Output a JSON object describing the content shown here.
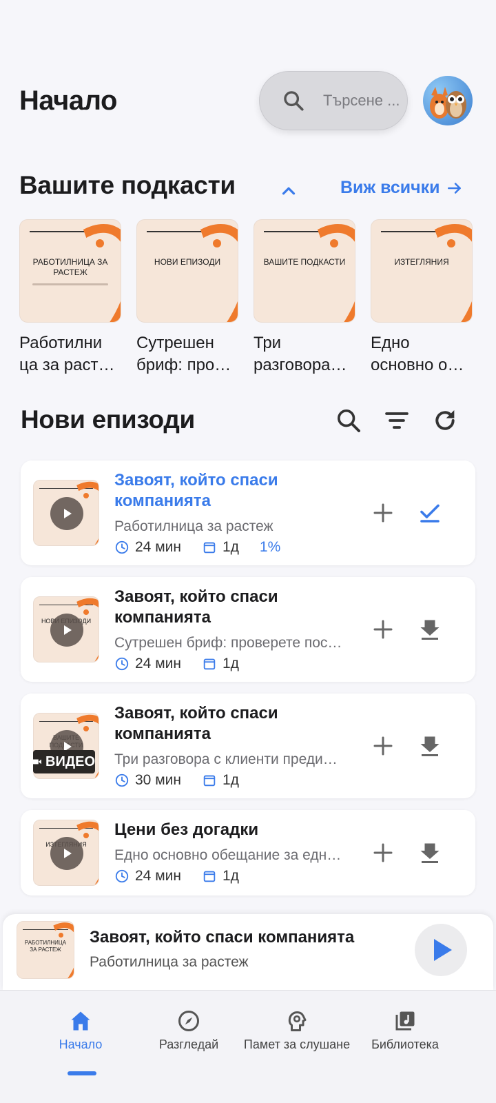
{
  "header": {
    "title": "Начало",
    "search_placeholder": "Търсене ..."
  },
  "podcasts_section": {
    "title": "Вашите подкасти",
    "see_all_label": "Виж всички",
    "items": [
      {
        "cover_text": "Работилница за растеж",
        "name": "Работилни ца за раст…"
      },
      {
        "cover_text": "Нови епизоди",
        "name": "Сутрешен бриф: про…"
      },
      {
        "cover_text": "Вашите подкасти",
        "name": "Три разговора…"
      },
      {
        "cover_text": "Изтегляния",
        "name": "Едно основно о…"
      }
    ]
  },
  "episodes_section": {
    "title": "Нови епизоди",
    "episodes": [
      {
        "title": "Завоят, който спаси компанията",
        "podcast": "Работилница за растеж",
        "duration": "24 мин",
        "date": "1д",
        "progress": "1%",
        "cover_text": "",
        "badge": "",
        "action": "check-icon",
        "active": true
      },
      {
        "title": "Завоят, който спаси компанията",
        "podcast": "Сутрешен бриф: проверете пос…",
        "duration": "24 мин",
        "date": "1д",
        "progress": "",
        "cover_text": "Нови епизоди",
        "badge": "",
        "action": "download-icon",
        "active": false
      },
      {
        "title": "Завоят, който спаси компанията",
        "podcast": "Три разговора с клиенти преди…",
        "duration": "30 мин",
        "date": "1д",
        "progress": "",
        "cover_text": "Вашите подкасти",
        "badge": "ВИДЕО",
        "action": "download-icon",
        "active": false
      },
      {
        "title": "Цени без догадки",
        "podcast": "Едно основно обещание за едн…",
        "duration": "24 мин",
        "date": "1д",
        "progress": "",
        "cover_text": "Изтегляния",
        "badge": "",
        "action": "download-icon",
        "active": false
      }
    ]
  },
  "mini_player": {
    "title": "Завоят, който спаси компанията",
    "podcast": "Работилница за растеж",
    "cover_text": "Работилница за растеж"
  },
  "bottom_nav": {
    "items": [
      {
        "label": "Начало",
        "icon": "home-icon",
        "active": true
      },
      {
        "label": "Разгледай",
        "icon": "compass-icon",
        "active": false
      },
      {
        "label": "Памет за слушане",
        "icon": "brain-icon",
        "active": false
      },
      {
        "label": "Библиотека",
        "icon": "library-icon",
        "active": false
      }
    ]
  },
  "colors": {
    "accent": "#3a7bea",
    "cover_orange": "#ef7a2c",
    "cover_bg": "#f6e6d9"
  }
}
